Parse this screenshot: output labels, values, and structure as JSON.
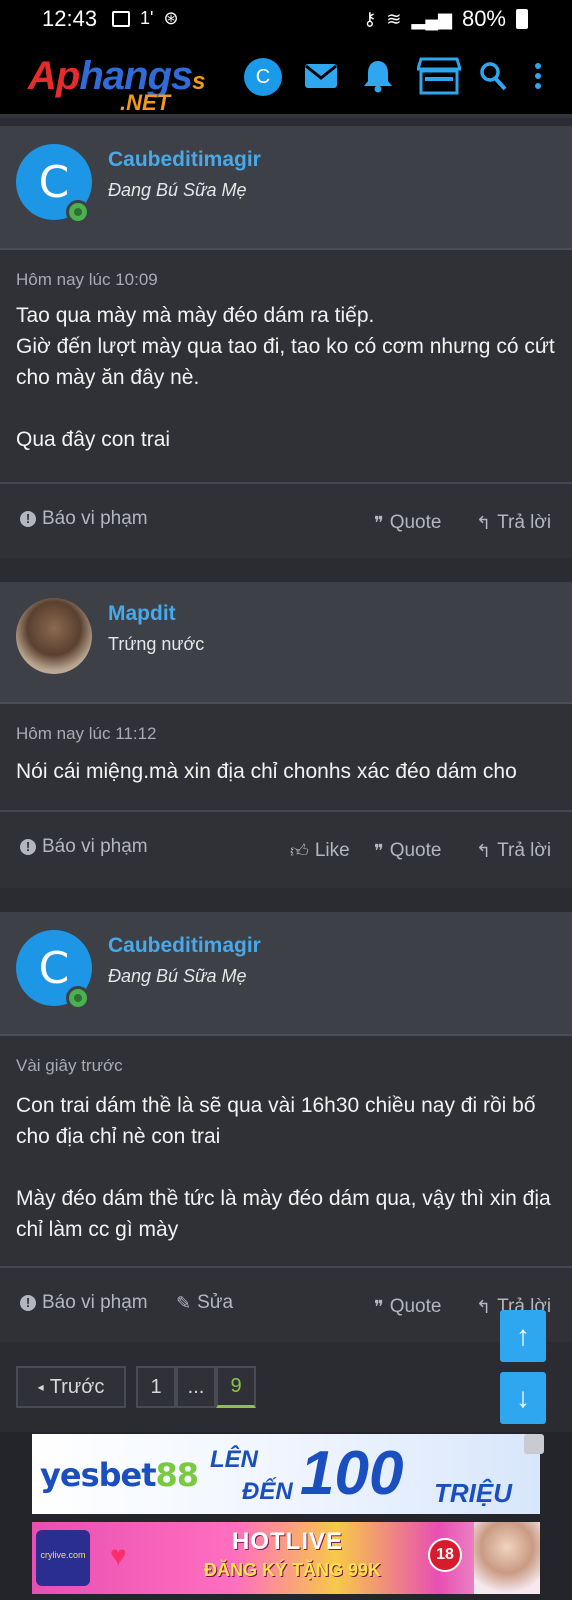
{
  "status_bar": {
    "time": "12:43",
    "signal_note": "1'",
    "battery": "80%"
  },
  "header": {
    "logo_part1": "Ap",
    "logo_part2": "hangs",
    "logo_part3": "s",
    "logo_sub": ".NET",
    "user_initial": "C"
  },
  "posts": [
    {
      "username": "Caubeditimagir",
      "title": "Đang Bú Sữa Mẹ",
      "avatar_initial": "C",
      "time": "Hôm nay lúc 10:09",
      "message": "Tao qua mày mà mày đéo dám ra tiếp.\nGiờ đến lượt mày qua tao đi, tao ko có cơm nhưng có cứt cho mày ăn đây nè.\n\nQua đây con trai",
      "report_label": "Báo vi phạm",
      "quote_label": "Quote",
      "reply_label": "Trả lời"
    },
    {
      "username": "Mapdit",
      "title": "Trứng nước",
      "time": "Hôm nay lúc 11:12",
      "message": "Nói cái miệng.mà xin địa chỉ chonhs xác đéo dám cho",
      "report_label": "Báo vi phạm",
      "like_label": "Like",
      "quote_label": "Quote",
      "reply_label": "Trả lời"
    },
    {
      "username": "Caubeditimagir",
      "title": "Đang Bú Sữa Mẹ",
      "avatar_initial": "C",
      "time": "Vài giây trước",
      "message": "Con trai dám thề là sẽ qua vài 16h30 chiều nay đi rồi bố cho địa chỉ nè con trai\n\nMày đéo dám thề tức là mày đéo dám qua, vậy thì xin địa chỉ làm cc gì mày",
      "report_label": "Báo vi phạm",
      "edit_label": "Sửa",
      "quote_label": "Quote",
      "reply_label": "Trả lời"
    }
  ],
  "pagination": {
    "prev_label": "Trước",
    "pages": [
      "1",
      "...",
      "9"
    ],
    "current": "9"
  },
  "ads": {
    "ad1_brand": "yesbet",
    "ad1_brand_num": "88",
    "ad1_len": "LÊN",
    "ad1_den": "ĐẾN",
    "ad1_amount": "100",
    "ad1_unit": "TRIỆU",
    "ad2_title": "HOTLIVE",
    "ad2_sub": "ĐĂNG KÝ TẶNG 99K",
    "ad2_age": "18",
    "ad2_thumb": "crylive.com"
  },
  "colors": {
    "accent": "#2ea6f0",
    "username": "#47a9ea",
    "online": "#4caf50",
    "current_page": "#8bc34a"
  }
}
